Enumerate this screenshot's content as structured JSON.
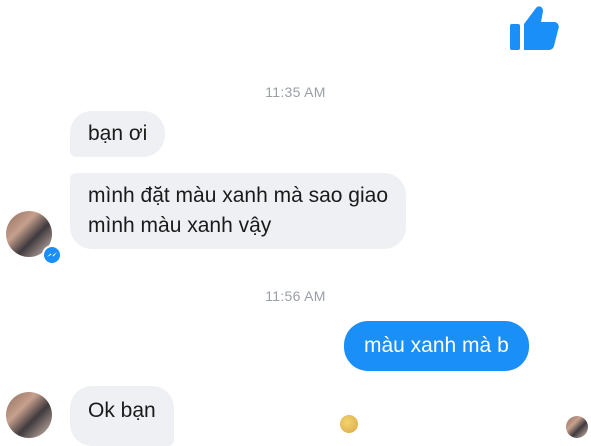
{
  "messages": {
    "time_1": "11:35 AM",
    "msg_1": "bạn ơi",
    "msg_2_line1": "mình đặt màu xanh mà sao giao",
    "msg_2_line2": "mình màu xanh vậy",
    "time_2": "11:56 AM",
    "reply_1": "màu xanh mà b",
    "msg_3": "Ok bạn"
  },
  "icons": {
    "like": "thumbs-up-icon",
    "messenger_badge": "messenger-badge-icon"
  },
  "colors": {
    "accent": "#1b8ff8",
    "incoming_bubble": "#eef0f3",
    "timestamp": "#9a9fa6"
  }
}
